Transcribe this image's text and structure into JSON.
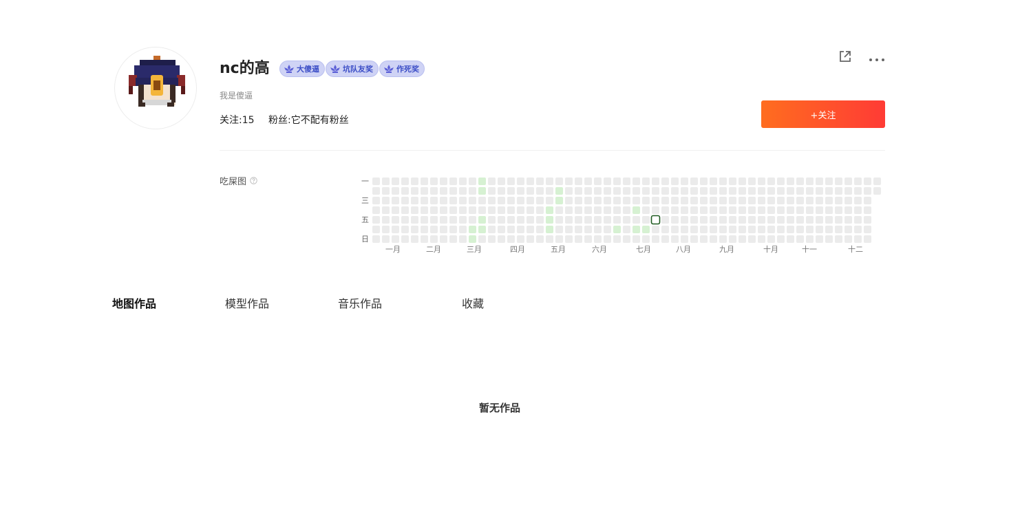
{
  "profile": {
    "username": "nc的高",
    "bio": "我是傻逼",
    "following_label": "关注:15",
    "followers_label": "粉丝:它不配有粉丝",
    "badges": [
      {
        "label": "大傻逼"
      },
      {
        "label": "坑队友奖"
      },
      {
        "label": "作死奖"
      }
    ],
    "follow_button": "+关注"
  },
  "heatmap": {
    "title": "吃屎图",
    "weekday_labels": [
      "一",
      "",
      "三",
      "",
      "五",
      "",
      "日"
    ],
    "month_labels": [
      "一月",
      "二月",
      "三月",
      "四月",
      "五月",
      "六月",
      "七月",
      "八月",
      "九月",
      "十月",
      "十一",
      "十二"
    ],
    "weeks": 53,
    "active_cells": [
      {
        "week": 10,
        "day": 5
      },
      {
        "week": 10,
        "day": 6
      },
      {
        "week": 11,
        "day": 0
      },
      {
        "week": 11,
        "day": 1
      },
      {
        "week": 11,
        "day": 4
      },
      {
        "week": 11,
        "day": 5
      },
      {
        "week": 19,
        "day": 1
      },
      {
        "week": 19,
        "day": 2
      },
      {
        "week": 18,
        "day": 3
      },
      {
        "week": 18,
        "day": 4
      },
      {
        "week": 18,
        "day": 5
      },
      {
        "week": 25,
        "day": 5
      },
      {
        "week": 27,
        "day": 3
      },
      {
        "week": 27,
        "day": 5
      },
      {
        "week": 28,
        "day": 5
      }
    ],
    "selected_cell": {
      "week": 29,
      "day": 4
    },
    "colors": {
      "empty": "#ebebeb",
      "active": "#d6f1d2",
      "selected_border": "#1e5a20"
    }
  },
  "tabs": [
    {
      "label": "地图作品",
      "active": true
    },
    {
      "label": "模型作品",
      "active": false
    },
    {
      "label": "音乐作品",
      "active": false
    },
    {
      "label": "收藏",
      "active": false
    }
  ],
  "empty_state": "暂无作品"
}
